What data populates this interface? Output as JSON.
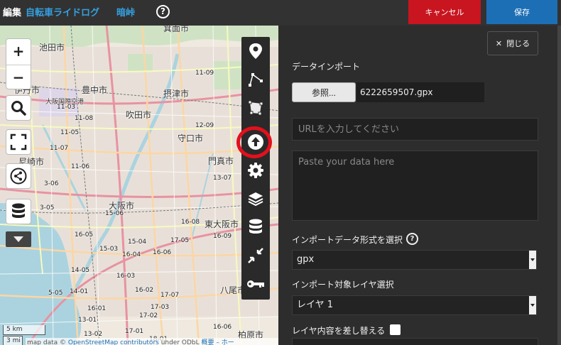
{
  "header": {
    "mode_label": "編集",
    "map_name": "自転車ライドログ",
    "user_name": "暗峠",
    "help_symbol": "?",
    "cancel_label": "キャンセル",
    "save_label": "保存"
  },
  "map": {
    "zoom_in": "+",
    "zoom_out": "−",
    "city_labels": [
      "池田市",
      "箕面市",
      "伊丹市",
      "豊中市",
      "大阪国際空港",
      "吹田市",
      "摂津市",
      "守口市",
      "門真市",
      "尼崎市",
      "大阪市",
      "東大阪市",
      "八尾市",
      "柏原市"
    ],
    "road_numbers": [
      "11-03",
      "11-09",
      "11-08",
      "11-05",
      "11-07",
      "11-06",
      "12-09",
      "13-07",
      "3-06",
      "3-05",
      "15-06",
      "16-05",
      "15-03",
      "15-04",
      "16-04",
      "16-03",
      "16-02",
      "16-01",
      "16-06",
      "14-05",
      "14-01",
      "5-05",
      "16-09",
      "16-08",
      "17-05",
      "17-07",
      "17-03",
      "17-02",
      "17-01",
      "16-06",
      "13-01",
      "13-02",
      "18-01"
    ],
    "scale_km": "5 km",
    "scale_mi": "3 mi",
    "attribution_prefix": "map data © ",
    "attribution_link": "OpenStreetMap contributors",
    "attribution_suffix": " under ODbL",
    "attribution_extra": "概要 – ホー"
  },
  "panel": {
    "close_label": "閉じる",
    "import_title": "データインポート",
    "browse_label": "参照...",
    "file_name": "6222659507.gpx",
    "url_placeholder": "URLを入力してください",
    "data_placeholder": "Paste your data here",
    "format_label": "インポートデータ形式を選択",
    "format_value": "gpx",
    "layer_label": "インポート対象レイヤ選択",
    "layer_value": "レイヤ 1",
    "replace_label": "レイヤ内容を差し替える"
  },
  "colors": {
    "cancel": "#c8151f",
    "save": "#1d6fb5",
    "link": "#34a0e0",
    "highlight": "#e3101c"
  }
}
